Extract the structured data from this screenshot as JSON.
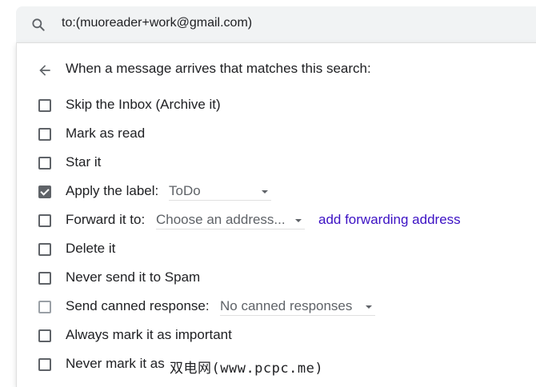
{
  "search": {
    "query": "to:(muoreader+work@gmail.com)"
  },
  "filter": {
    "header": "When a message arrives that matches this search:",
    "options": [
      {
        "label": "Skip the Inbox (Archive it)",
        "checked": false
      },
      {
        "label": "Mark as read",
        "checked": false
      },
      {
        "label": "Star it",
        "checked": false
      },
      {
        "label": "Apply the label:",
        "checked": true,
        "select": "ToDo"
      },
      {
        "label": "Forward it to:",
        "checked": false,
        "select": "Choose an address...",
        "link": "add forwarding address"
      },
      {
        "label": "Delete it",
        "checked": false
      },
      {
        "label": "Never send it to Spam",
        "checked": false
      },
      {
        "label": "Send canned response:",
        "checked": false,
        "disabled": true,
        "select": "No canned responses"
      },
      {
        "label": "Always mark it as important",
        "checked": false
      },
      {
        "label": "Never mark it as",
        "checked": false
      }
    ]
  },
  "watermark": "双电网(www.pcpc.me)",
  "colors": {
    "link": "#3c11c4",
    "text": "#202124",
    "checkbox": "#5f6368",
    "search_bg": "#f1f3f4"
  }
}
